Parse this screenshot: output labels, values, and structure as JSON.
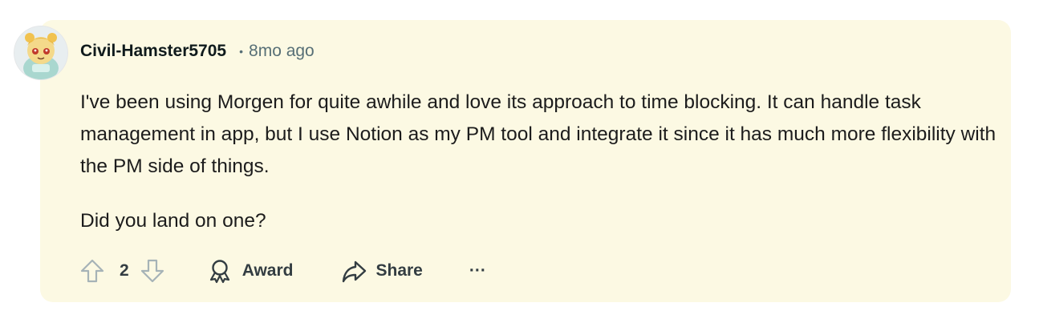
{
  "comment": {
    "author": "Civil-Hamster5705",
    "separator": "•",
    "time_ago": "8mo ago",
    "paragraphs": [
      "I've been using Morgen for quite awhile and love its approach to time blocking. It can handle task management in app, but I use Notion as my PM tool and integrate it since it has much more flexibility with the PM side of things.",
      "Did you land on one?"
    ],
    "vote_count": "2",
    "actions": {
      "award_label": "Award",
      "share_label": "Share",
      "more_label": "···"
    }
  },
  "colors": {
    "card_background": "#fcf9e3",
    "meta_text": "#576f76",
    "action_text": "#333d42"
  },
  "icons": [
    "avatar-image",
    "upvote-icon",
    "downvote-icon",
    "award-icon",
    "share-icon",
    "more-icon"
  ]
}
